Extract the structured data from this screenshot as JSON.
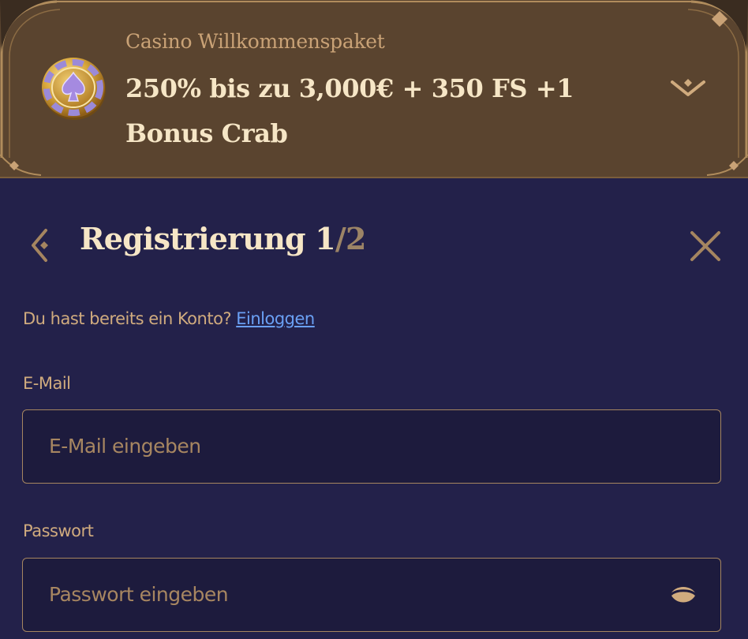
{
  "promo": {
    "subtitle": "Casino Willkommenspaket",
    "title": "250% bis zu 3,000€ + 350 FS +1 Bonus Crab"
  },
  "header": {
    "title_main": "Registrierung 1",
    "title_total": "/2"
  },
  "login": {
    "prompt": "Du hast bereits ein Konto?",
    "link_label": "Einloggen"
  },
  "form": {
    "email": {
      "label": "E-Mail",
      "placeholder": "E-Mail eingeben",
      "value": ""
    },
    "password": {
      "label": "Passwort",
      "placeholder": "Passwort eingeben",
      "value": ""
    }
  },
  "icons": {
    "coin": "coin-spade-icon",
    "expand": "chevron-down-icon",
    "back": "arrow-left-icon",
    "close": "close-icon",
    "visibility": "eye-icon"
  },
  "colors": {
    "background": "#23214a",
    "banner": "#5a442f",
    "gold": "#d0ab7e",
    "cream": "#f6e6c6",
    "link": "#6aa0f4",
    "field_border": "#a58560"
  }
}
